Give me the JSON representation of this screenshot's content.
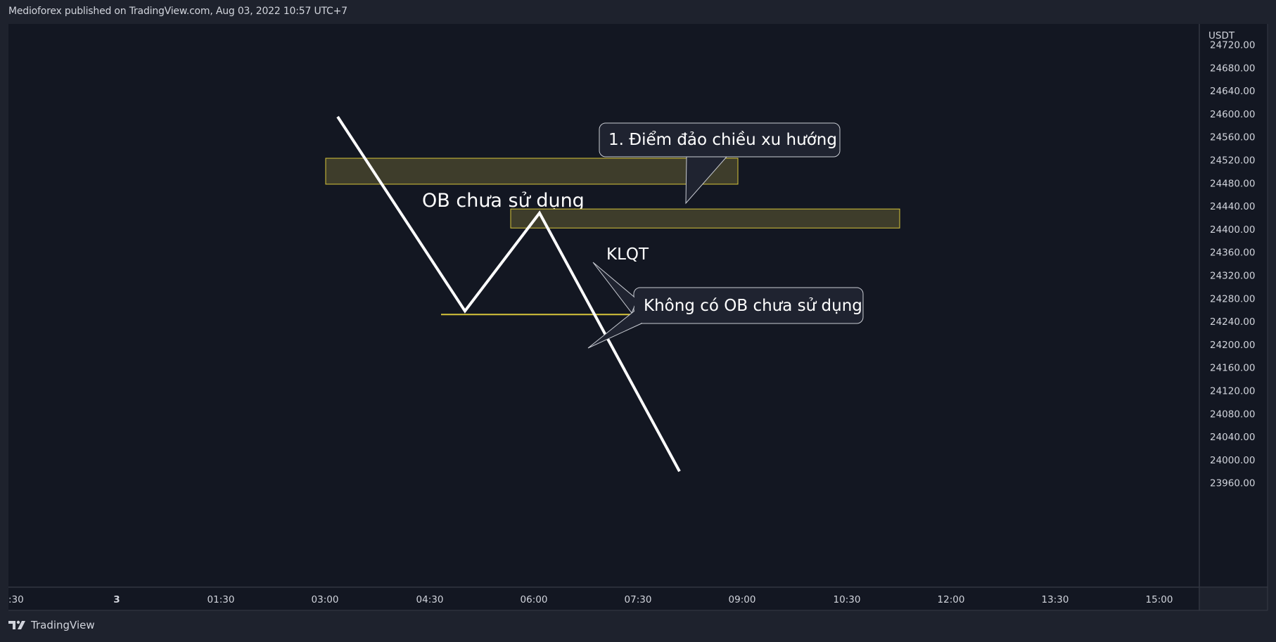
{
  "header": {
    "published_line": "Medioforex published on TradingView.com, Aug 03, 2022 10:57 UTC+7"
  },
  "footer": {
    "brand": "TradingView",
    "logo_icon": "tradingview-logo-icon"
  },
  "colors": {
    "background": "#1e222d",
    "pane": "#131722",
    "axis_border": "#363a45",
    "price_line": "#ffffff",
    "zone_fill": "#3e3d2b",
    "zone_border": "#d7c53a",
    "level_line": "#d7c53a",
    "callout_fill": "#1f2330",
    "callout_border": "#c9ccd3",
    "text": "#d1d4dc"
  },
  "chart_data": {
    "type": "line",
    "price_axis_unit": "USDT",
    "y_ticks": [
      "24720.00",
      "24680.00",
      "24640.00",
      "24600.00",
      "24560.00",
      "24520.00",
      "24480.00",
      "24440.00",
      "24400.00",
      "24360.00",
      "24320.00",
      "24280.00",
      "24240.00",
      "24200.00",
      "24160.00",
      "24120.00",
      "24080.00",
      "24040.00",
      "24000.00",
      "23960.00"
    ],
    "x_ticks": [
      ":30",
      "3",
      "01:30",
      "03:00",
      "04:30",
      "06:00",
      "07:30",
      "09:00",
      "10:30",
      "12:00",
      "13:30",
      "15:00"
    ],
    "ylim": [
      23945,
      24730
    ],
    "grid": false,
    "series": [
      {
        "points": [
          {
            "x": "03:10",
            "y": 24595
          },
          {
            "x": "05:00",
            "y": 24258
          },
          {
            "x": "06:05",
            "y": 24428
          },
          {
            "x": "07:50",
            "y": 23980
          }
        ]
      }
    ],
    "zones": [
      {
        "label": "OB chưa sử dụng",
        "x_from": "03:00",
        "x_to": "09:00",
        "y_top": 24523,
        "y_bottom": 24478
      },
      {
        "label": "KLQT",
        "x_from": "05:40",
        "x_to": "11:10",
        "y_top": 24435,
        "y_bottom": 24402
      }
    ],
    "levels": [
      {
        "x_from": "04:40",
        "x_to": "09:20",
        "y": 24252
      }
    ],
    "annotations": [
      {
        "text": "1. Điểm đảo chiều xu hướng"
      },
      {
        "text": "Không có OB chưa sử dụng"
      }
    ]
  }
}
